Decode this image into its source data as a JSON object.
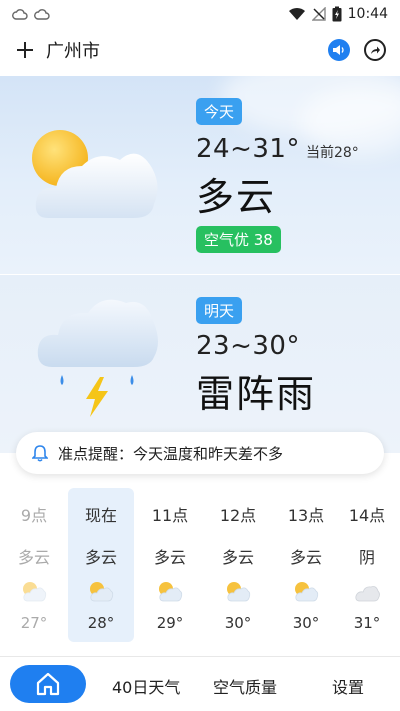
{
  "status_bar": {
    "time": "10:44"
  },
  "header": {
    "city": "广州市"
  },
  "today": {
    "badge": "今天",
    "temp_range": "24~31°",
    "current": "当前28°",
    "condition": "多云",
    "aqi": "空气优 38"
  },
  "tomorrow": {
    "badge": "明天",
    "temp_range": "23~30°",
    "condition": "雷阵雨"
  },
  "reminder": {
    "text": "准点提醒：今天温度和昨天差不多"
  },
  "hourly": [
    {
      "time": "9点",
      "condition": "多云",
      "temp": "27°",
      "icon": "partly-cloudy-icon"
    },
    {
      "time": "现在",
      "condition": "多云",
      "temp": "28°",
      "icon": "partly-cloudy-icon"
    },
    {
      "time": "11点",
      "condition": "多云",
      "temp": "29°",
      "icon": "partly-cloudy-icon"
    },
    {
      "time": "12点",
      "condition": "多云",
      "temp": "30°",
      "icon": "partly-cloudy-icon"
    },
    {
      "time": "13点",
      "condition": "多云",
      "temp": "30°",
      "icon": "partly-cloudy-icon"
    },
    {
      "time": "14点",
      "condition": "阴",
      "temp": "31°",
      "icon": "overcast-icon"
    }
  ],
  "nav": {
    "home_icon": "home-icon",
    "forecast": "40日天气",
    "air": "空气质量",
    "settings": "设置"
  },
  "colors": {
    "accent": "#1f7ff0",
    "badge_blue": "#3aa0f0",
    "aqi_green": "#27c060"
  }
}
